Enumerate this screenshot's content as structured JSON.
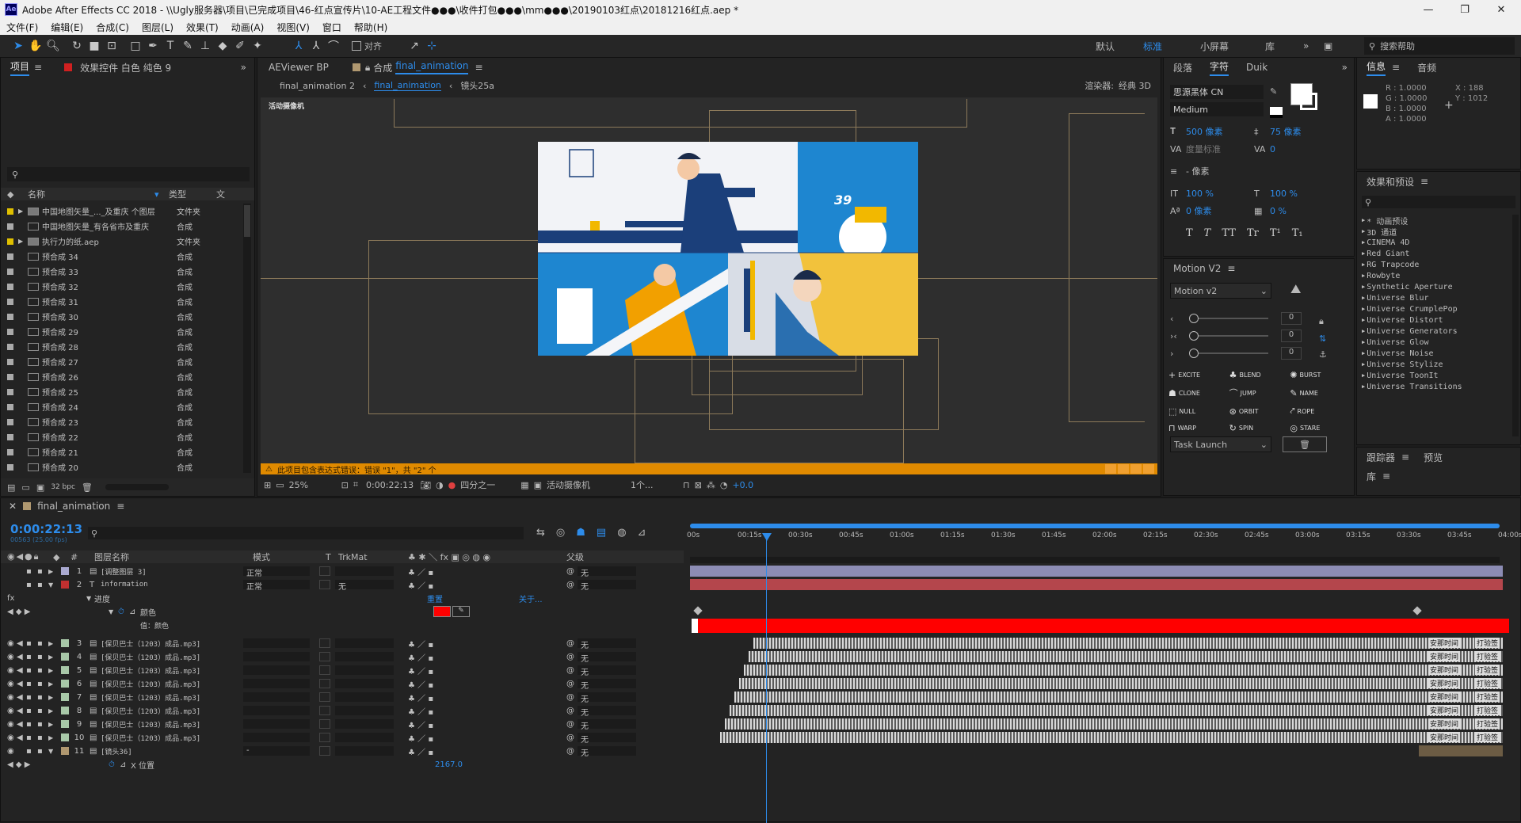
{
  "window": {
    "title": "Adobe After Effects CC 2018 - \\\\Ugly服务器\\项目\\已完成项目\\46-红点宣传片\\10-AE工程文件●●●\\收件打包●●●\\mm●●●\\20190103红点\\20181216红点.aep *",
    "minimize": "—",
    "restore": "❐",
    "close": "✕"
  },
  "menu": [
    "文件(F)",
    "编辑(E)",
    "合成(C)",
    "图层(L)",
    "效果(T)",
    "动画(A)",
    "视图(V)",
    "窗口",
    "帮助(H)"
  ],
  "toolbar": {
    "align_label": "对齐",
    "workspaces": [
      "默认",
      "标准",
      "小屏幕",
      "库"
    ],
    "active_workspace": "标准",
    "search_help": "搜索帮助"
  },
  "project_panel": {
    "tab_project": "项目",
    "tab_effects": "效果控件 白色 纯色 9",
    "search_placeholder": "",
    "col_name": "名称",
    "col_type": "类型",
    "col_extra": "文",
    "items": [
      {
        "name": "中国地图矢量_..._及重庆 个图层",
        "type": "文件夹",
        "color": "#e0c000",
        "folder": true
      },
      {
        "name": "中国地图矢量_有各省市及重庆",
        "type": "合成",
        "color": "#aaaaaa",
        "folder": false
      },
      {
        "name": "执行力的纸.aep",
        "type": "文件夹",
        "color": "#e0c000",
        "folder": true
      },
      {
        "name": "预合成 34",
        "type": "合成",
        "color": "#aaaaaa",
        "folder": false
      },
      {
        "name": "预合成 33",
        "type": "合成",
        "color": "#aaaaaa",
        "folder": false
      },
      {
        "name": "预合成 32",
        "type": "合成",
        "color": "#aaaaaa",
        "folder": false
      },
      {
        "name": "预合成 31",
        "type": "合成",
        "color": "#aaaaaa",
        "folder": false
      },
      {
        "name": "预合成 30",
        "type": "合成",
        "color": "#aaaaaa",
        "folder": false
      },
      {
        "name": "预合成 29",
        "type": "合成",
        "color": "#aaaaaa",
        "folder": false
      },
      {
        "name": "预合成 28",
        "type": "合成",
        "color": "#aaaaaa",
        "folder": false
      },
      {
        "name": "预合成 27",
        "type": "合成",
        "color": "#aaaaaa",
        "folder": false
      },
      {
        "name": "预合成 26",
        "type": "合成",
        "color": "#aaaaaa",
        "folder": false
      },
      {
        "name": "预合成 25",
        "type": "合成",
        "color": "#aaaaaa",
        "folder": false
      },
      {
        "name": "预合成 24",
        "type": "合成",
        "color": "#aaaaaa",
        "folder": false
      },
      {
        "name": "预合成 23",
        "type": "合成",
        "color": "#aaaaaa",
        "folder": false
      },
      {
        "name": "预合成 22",
        "type": "合成",
        "color": "#aaaaaa",
        "folder": false
      },
      {
        "name": "预合成 21",
        "type": "合成",
        "color": "#aaaaaa",
        "folder": false
      },
      {
        "name": "预合成 20",
        "type": "合成",
        "color": "#aaaaaa",
        "folder": false
      }
    ],
    "bpc": "32 bpc"
  },
  "comp_panel": {
    "tab_aeviewer": "AEViewer BP",
    "tab_comp_prefix": "合成",
    "tab_comp_name": "final_animation",
    "breadcrumbs": [
      "final_animation 2",
      "final_animation",
      "镜头25a"
    ],
    "renderer_label": "渲染器:",
    "renderer_value": "经典 3D",
    "camera_label": "活动摄像机",
    "warning": "此项目包含表达式错误：错误 \"1\"，共 \"2\" 个",
    "zoom": "25%",
    "timecode": "0:00:22:13",
    "resolution": "四分之一",
    "view": "活动摄像机",
    "views_count": "1个...",
    "exposure": "+0.0",
    "artwork_number": "39"
  },
  "character_panel": {
    "tab_paragraph": "段落",
    "tab_character": "字符",
    "tab_duik": "Duik",
    "font": "思源黑体 CN",
    "style": "Medium",
    "size": "500 像素",
    "leading": "75 像素",
    "kerning": "度量标准",
    "tracking": "0",
    "stroke": "- 像素",
    "vscale": "100 %",
    "hscale": "100 %",
    "baseline": "0 像素",
    "tsume": "0 %",
    "styles": [
      "T",
      "T",
      "TT",
      "Tr",
      "T¹",
      "T₁"
    ]
  },
  "motion_panel": {
    "title": "Motion V2",
    "preset": "Motion v2",
    "sliders": [
      {
        "icon": "‹",
        "value": "0"
      },
      {
        "icon": "›‹",
        "value": "0"
      },
      {
        "icon": "›",
        "value": "0"
      }
    ],
    "buttons": [
      "EXCITE",
      "BLEND",
      "BURST",
      "CLONE",
      "JUMP",
      "NAME",
      "NULL",
      "ORBIT",
      "ROPE",
      "WARP",
      "SPIN",
      "STARE"
    ],
    "task": "Task Launch"
  },
  "info_panel": {
    "tab_info": "信息",
    "tab_audio": "音频",
    "r": "R : 1.0000",
    "g": "G : 1.0000",
    "b": "B : 1.0000",
    "a": "A : 1.0000",
    "x": "X : 188",
    "y": "Y : 1012"
  },
  "effects_panel": {
    "title": "效果和预设",
    "items": [
      "* 动画预设",
      "3D 通道",
      "CINEMA 4D",
      "Red Giant",
      "RG Trapcode",
      "Rowbyte",
      "Synthetic Aperture",
      "Universe Blur",
      "Universe CrumplePop",
      "Universe Distort",
      "Universe Generators",
      "Universe Glow",
      "Universe Noise",
      "Universe Stylize",
      "Universe ToonIt",
      "Universe Transitions"
    ]
  },
  "tracker_panel": {
    "tab_tracker": "跟踪器",
    "tab_preview": "预览",
    "tab_library": "库"
  },
  "timeline": {
    "comp_name": "final_animation",
    "timecode": "0:00:22:13",
    "frames": "00563 (25.00 fps)",
    "col_layer_name": "图层名称",
    "col_mode": "模式",
    "col_t": "T",
    "col_trkmat": "TrkMat",
    "col_parent": "父级",
    "ruler": [
      "00s",
      "00:15s",
      "00:30s",
      "00:45s",
      "01:00s",
      "01:15s",
      "01:30s",
      "01:45s",
      "02:00s",
      "02:15s",
      "02:30s",
      "02:45s",
      "03:00s",
      "03:15s",
      "03:30s",
      "03:45s",
      "04:00s"
    ],
    "layers": [
      {
        "num": "1",
        "name": "[调整图层 3]",
        "mode": "正常",
        "trk": "",
        "parent": "无",
        "label": "#a9a9d0",
        "expanded": false
      },
      {
        "num": "2",
        "name": "information",
        "mode": "正常",
        "trk": "无",
        "parent": "无",
        "label": "#c03030",
        "expanded": true
      },
      {
        "num": "3",
        "name": "[保贝巴士（1203）成品.mp3]",
        "mode": "",
        "trk": "",
        "parent": "无",
        "label": "#a8c8a8",
        "expanded": false
      },
      {
        "num": "4",
        "name": "[保贝巴士（1203）成品.mp3]",
        "mode": "",
        "trk": "",
        "parent": "无",
        "label": "#a8c8a8",
        "expanded": false
      },
      {
        "num": "5",
        "name": "[保贝巴士（1203）成品.mp3]",
        "mode": "",
        "trk": "",
        "parent": "无",
        "label": "#a8c8a8",
        "expanded": false
      },
      {
        "num": "6",
        "name": "[保贝巴士（1203）成品.mp3]",
        "mode": "",
        "trk": "",
        "parent": "无",
        "label": "#a8c8a8",
        "expanded": false
      },
      {
        "num": "7",
        "name": "[保贝巴士（1203）成品.mp3]",
        "mode": "",
        "trk": "",
        "parent": "无",
        "label": "#a8c8a8",
        "expanded": false
      },
      {
        "num": "8",
        "name": "[保贝巴士（1203）成品.mp3]",
        "mode": "",
        "trk": "",
        "parent": "无",
        "label": "#a8c8a8",
        "expanded": false
      },
      {
        "num": "9",
        "name": "[保贝巴士（1203）成品.mp3]",
        "mode": "",
        "trk": "",
        "parent": "无",
        "label": "#a8c8a8",
        "expanded": false
      },
      {
        "num": "10",
        "name": "[保贝巴士（1203）成品.mp3]",
        "mode": "",
        "trk": "",
        "parent": "无",
        "label": "#a8c8a8",
        "expanded": false
      },
      {
        "num": "11",
        "name": "[镜头36]",
        "mode": "-",
        "trk": "",
        "parent": "无",
        "label": "#b09870",
        "expanded": true
      }
    ],
    "effect_group": "进度",
    "effect_reset": "重置",
    "effect_about": "关于...",
    "color_prop": "颜色",
    "value_label": "值：颜色",
    "position_label": "X 位置",
    "position_value": "2167.0",
    "audio_tag1": "安那时间",
    "audio_tag2": "打验签"
  },
  "colors": {
    "accent": "#2d8ceb",
    "warning": "#e08a00",
    "track_purple": "#8c8cb4",
    "track_red": "#b4464c",
    "color_bar": "#ff0000"
  }
}
